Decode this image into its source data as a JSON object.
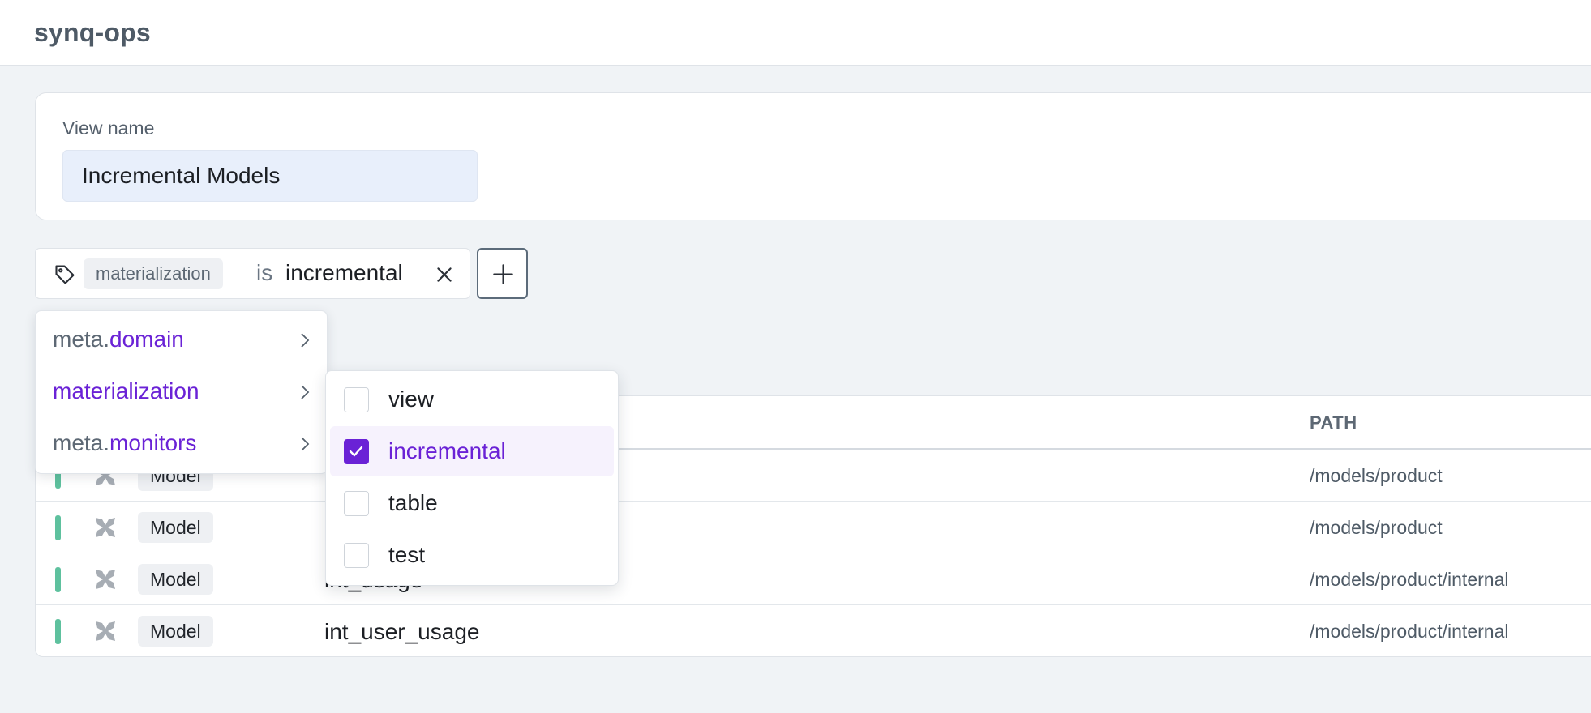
{
  "app": {
    "title": "synq-ops"
  },
  "view": {
    "label": "View name",
    "name_value": "Incremental Models"
  },
  "filter": {
    "key": "materialization",
    "operator": "is",
    "value": "incremental",
    "tag_icon": "tag-icon",
    "close_icon": "close-icon"
  },
  "add_button": {
    "icon": "plus-icon"
  },
  "attribute_menu": {
    "items": [
      {
        "prefix": "meta.",
        "accent": "domain",
        "icon": "chevron-right-icon"
      },
      {
        "prefix": "",
        "accent": "materialization",
        "icon": "chevron-right-icon"
      },
      {
        "prefix": "meta.",
        "accent": "monitors",
        "icon": "chevron-right-icon"
      }
    ]
  },
  "value_menu": {
    "options": [
      {
        "label": "view",
        "checked": false
      },
      {
        "label": "incremental",
        "checked": true
      },
      {
        "label": "table",
        "checked": false
      },
      {
        "label": "test",
        "checked": false
      }
    ]
  },
  "table": {
    "headers": {
      "path": "PATH"
    },
    "rows": [
      {
        "type": "Model",
        "name": "",
        "path": "/models/product",
        "status_color": "#5ec19e"
      },
      {
        "type": "Model",
        "name": "",
        "path": "/models/product",
        "status_color": "#5ec19e"
      },
      {
        "type": "Model",
        "name": "int_usage",
        "path": "/models/product/internal",
        "status_color": "#5ec19e"
      },
      {
        "type": "Model",
        "name": "int_user_usage",
        "path": "/models/product/internal",
        "status_color": "#5ec19e"
      }
    ]
  },
  "colors": {
    "accent": "#6a22d6",
    "status_ok": "#5ec19e"
  }
}
